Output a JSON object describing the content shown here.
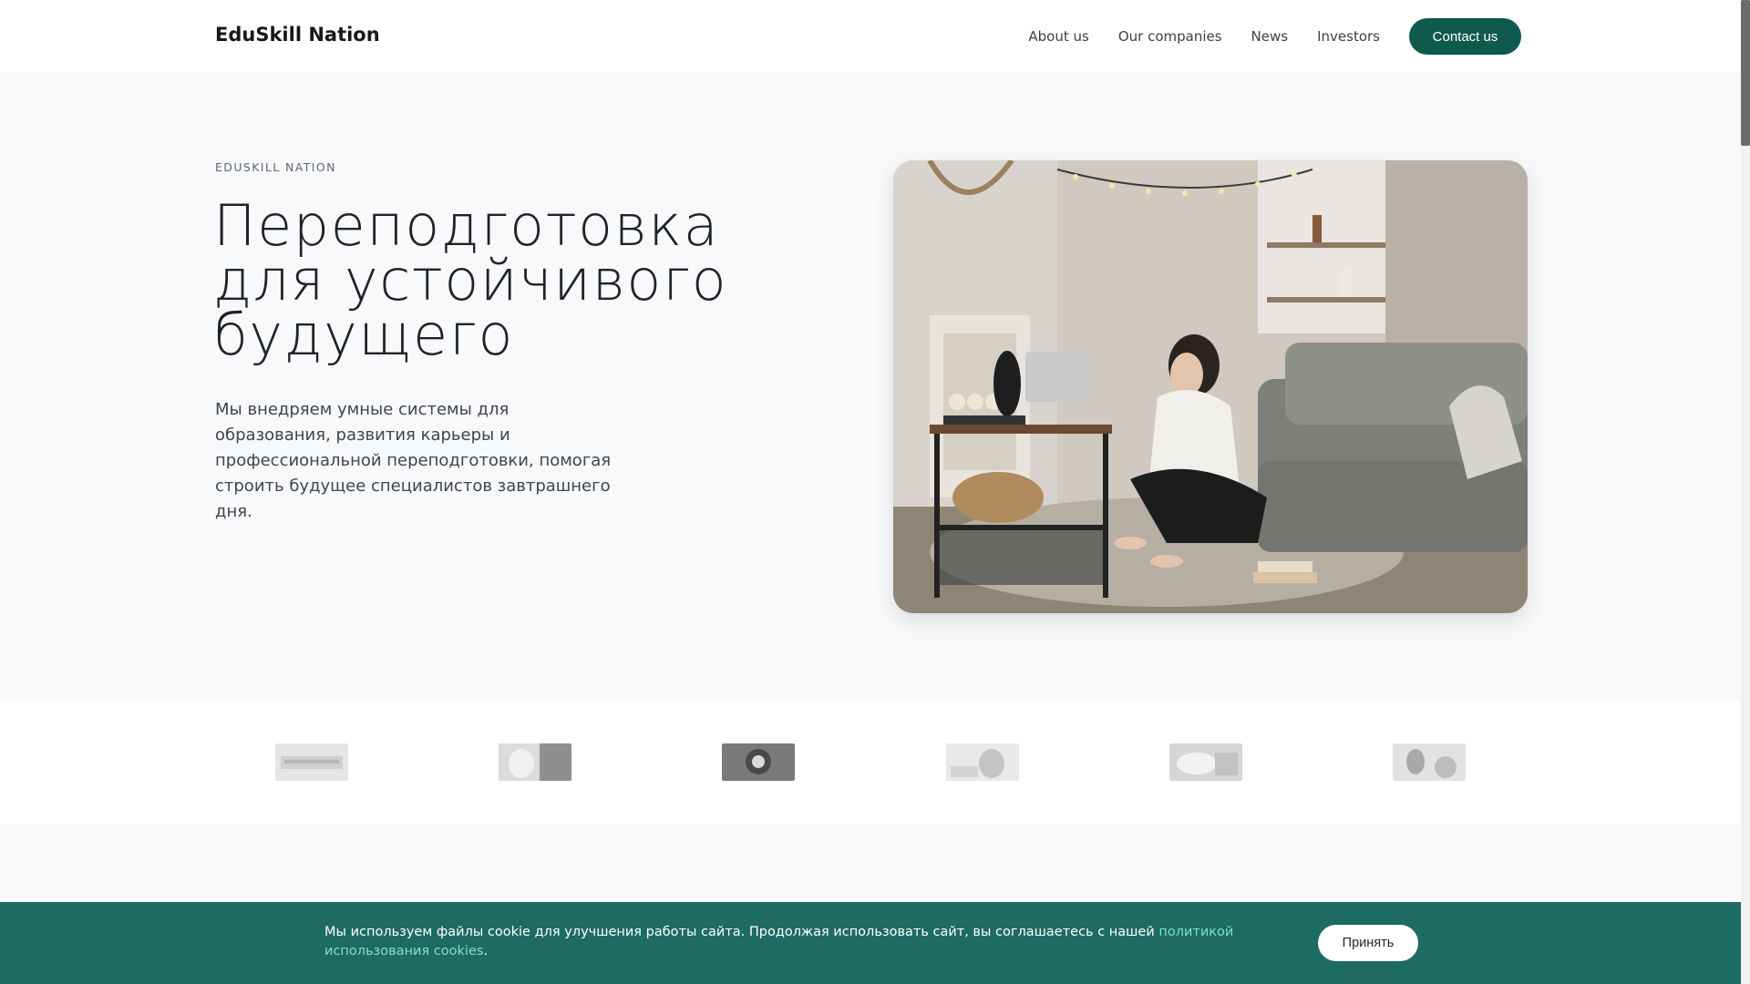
{
  "header": {
    "brand": "EduSkill Nation",
    "nav": [
      "About us",
      "Our companies",
      "News",
      "Investors"
    ],
    "contact_label": "Contact us"
  },
  "hero": {
    "eyebrow": "EDUSKILL NATION",
    "title_lines": [
      "Переподготовка",
      "для устойчивого",
      "будущего"
    ],
    "description": "Мы внедряем умные системы для образования, развития карьеры и профессиональной переподготовки, помогая строить будущее специалистов завтрашнего дня."
  },
  "partners": {
    "logo_count": 6
  },
  "cookie": {
    "text": "Мы используем файлы cookie для улучшения работы сайта. Продолжая использовать сайт, вы соглашаетесь с нашей ",
    "link_text": "политикой использования cookies",
    "suffix": ".",
    "accept_label": "Принять"
  },
  "colors": {
    "accent": "#0f5a4f",
    "banner": "#1d6b63",
    "link": "#7ee0d1",
    "page_bg": "#f8f9fb"
  }
}
